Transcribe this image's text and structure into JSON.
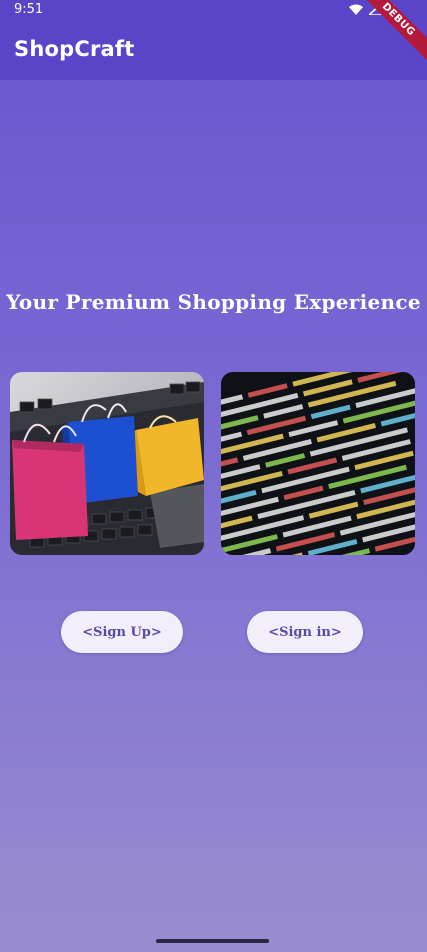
{
  "status_bar": {
    "time": "9:51",
    "icons": [
      "wifi-icon",
      "signal-icon",
      "battery-icon"
    ]
  },
  "app_bar": {
    "title": "ShopCraft"
  },
  "debug_banner": {
    "label": "DEBUG",
    "color": "#b3193a"
  },
  "hero": {
    "headline": "Your Premium Shopping Experience"
  },
  "images": [
    {
      "name": "shopping-bags-on-laptop-image"
    },
    {
      "name": "code-screen-image"
    }
  ],
  "buttons": {
    "sign_up": "<Sign Up>",
    "sign_in": "<Sign in>"
  },
  "colors": {
    "app_bar": "#5a45c8",
    "background_top": "#6a55d0",
    "background_bottom": "#9a8ccf",
    "button_bg": "#f3effa",
    "button_text": "#5a4aa8"
  }
}
